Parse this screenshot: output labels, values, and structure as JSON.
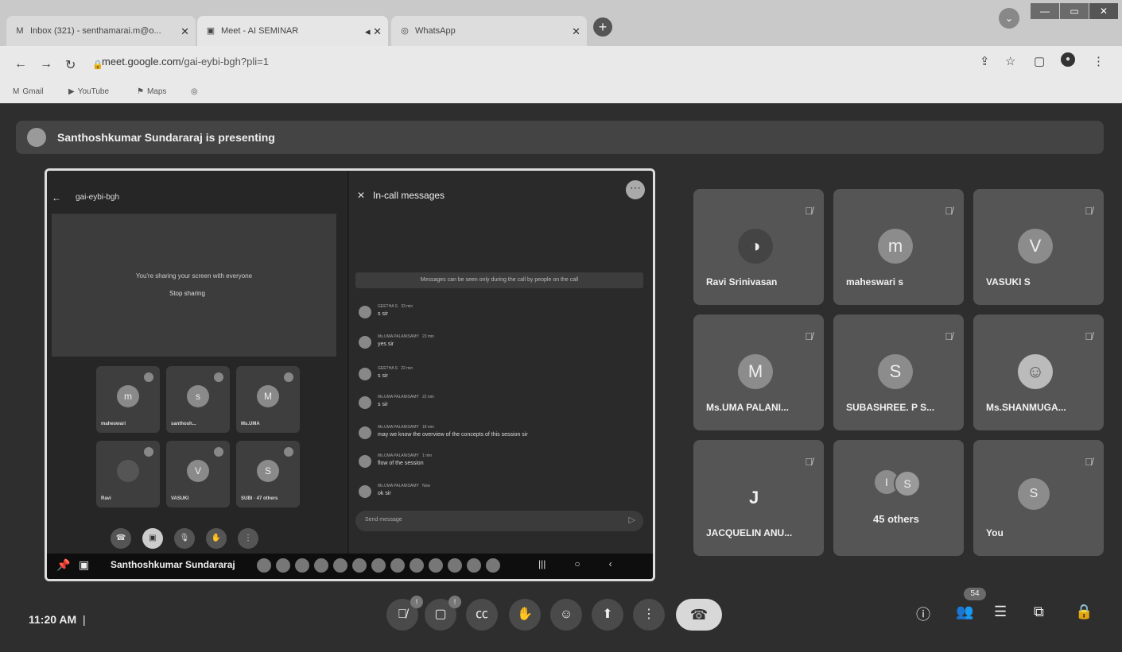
{
  "browser": {
    "tabs": [
      {
        "icon": "M",
        "label": "Inbox (321) - senthamarai.m@o..."
      },
      {
        "icon": "▣",
        "label": "Meet - AI SEMINAR"
      },
      {
        "icon": "◎",
        "label": "WhatsApp"
      }
    ],
    "new_tab": "+",
    "url_host": "meet.google.com",
    "url_path": "/gai-eybi-bgh?pli=1",
    "bookmarks": [
      "Gmail",
      "YouTube",
      "Maps"
    ]
  },
  "meet": {
    "presenting_banner": "Santhoshkumar Sundararaj is presenting",
    "shared_screen": {
      "meeting_code": "gai-eybi-bgh",
      "sharing_text": "You're sharing your screen with everyone",
      "stop_sharing": "Stop sharing",
      "mini_tiles": [
        {
          "letter": "m",
          "name": "maheswari"
        },
        {
          "letter": "s",
          "name": "santhosh..."
        },
        {
          "letter": "M",
          "name": "Ms.UMA"
        },
        {
          "letter": "",
          "name": "Ravi"
        },
        {
          "letter": "V",
          "name": "VASUKI"
        },
        {
          "letter": "S",
          "name": "SUBI · 47 others"
        }
      ],
      "chat_title": "In-call messages",
      "chat_note": "Messages can be seen only during the call by people on the call",
      "messages": [
        {
          "sender": "GEETHA S",
          "time": "33 min",
          "text": "s sir"
        },
        {
          "sender": "Ms.UMA PALANISAMY",
          "time": "23 min",
          "text": "yes sir"
        },
        {
          "sender": "GEETHA S",
          "time": "22 min",
          "text": "s sir"
        },
        {
          "sender": "Ms.UMA PALANISAMY",
          "time": "22 min",
          "text": "s sir"
        },
        {
          "sender": "Ms.UMA PALANISAMY",
          "time": "18 min",
          "text": "may we know the overview  of the concepts of this session sir"
        },
        {
          "sender": "Ms.UMA PALANISAMY",
          "time": "1 min",
          "text": "flow of the session"
        },
        {
          "sender": "Ms.UMA PALANISAMY",
          "time": "Now",
          "text": "ok sir"
        }
      ],
      "send_placeholder": "Send message",
      "presenter_name": "Santhoshkumar Sundararaj"
    },
    "participants": [
      {
        "letter": "",
        "name": "Ravi Srinivasan"
      },
      {
        "letter": "m",
        "name": "maheswari s"
      },
      {
        "letter": "V",
        "name": "VASUKI S"
      },
      {
        "letter": "M",
        "name": "Ms.UMA PALANI..."
      },
      {
        "letter": "S",
        "name": "SUBASHREE. P S..."
      },
      {
        "letter": "",
        "name": "Ms.SHANMUGA..."
      },
      {
        "letter": "J",
        "name": "JACQUELIN ANU..."
      },
      {
        "letter": "",
        "name": "45 others",
        "stack": [
          "I",
          "S"
        ]
      },
      {
        "letter": "S",
        "name": "You"
      }
    ],
    "clock": "11:20 AM",
    "separator": "|",
    "participant_count": "54",
    "colors": {
      "surface": "#2e2e2e",
      "tile": "#555555",
      "banner": "#444444"
    }
  }
}
